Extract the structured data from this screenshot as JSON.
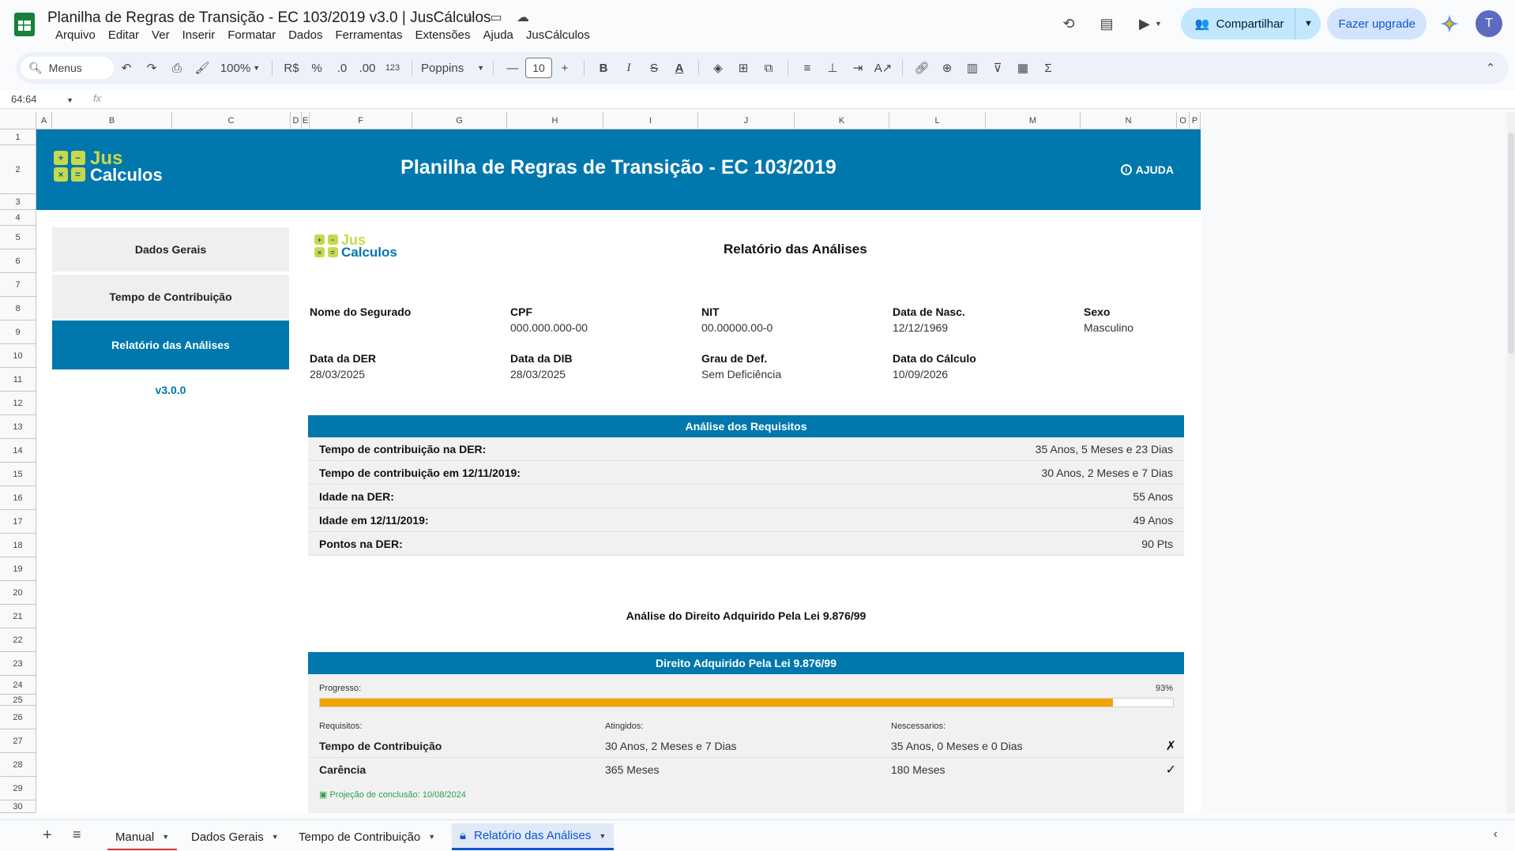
{
  "app": {
    "title": "Planilha de Regras de Transição - EC 103/2019 v3.0 | JusCálculos",
    "menu": [
      "Arquivo",
      "Editar",
      "Ver",
      "Inserir",
      "Formatar",
      "Dados",
      "Ferramentas",
      "Extensões",
      "Ajuda",
      "JusCálculos"
    ],
    "share_label": "Compartilhar",
    "upgrade_label": "Fazer upgrade",
    "avatar_letter": "T"
  },
  "toolbar": {
    "search_label": "Menus",
    "zoom": "100%",
    "currency": "R$",
    "percent": "%",
    "dec_decrease": ".0",
    "dec_increase": ".00",
    "number_format": "123",
    "font": "Poppins",
    "font_size": "10"
  },
  "formula_bar": {
    "cell_ref": "64:64",
    "fx": "fx"
  },
  "columns": [
    "A",
    "B",
    "C",
    "D",
    "E",
    "F",
    "G",
    "H",
    "I",
    "J",
    "K",
    "L",
    "M",
    "N",
    "O",
    "P"
  ],
  "rows": [
    "1",
    "2",
    "3",
    "4",
    "5",
    "6",
    "7",
    "8",
    "9",
    "10",
    "11",
    "12",
    "13",
    "14",
    "15",
    "16",
    "17",
    "18",
    "19",
    "20",
    "21",
    "22",
    "23",
    "24",
    "25",
    "26",
    "27",
    "28",
    "29",
    "30"
  ],
  "banner": {
    "title": "Planilha de Regras de Transição - EC 103/2019",
    "help_label": "AJUDA",
    "logo_top": "Jus",
    "logo_bottom": "Calculos"
  },
  "nav": {
    "items": [
      "Dados Gerais",
      "Tempo de Contribuição",
      "Relatório das Análises"
    ],
    "version": "v3.0.0"
  },
  "report": {
    "title": "Relatório das Análises",
    "fields": [
      {
        "label": "Nome do Segurado",
        "value": ""
      },
      {
        "label": "CPF",
        "value": "000.000.000-00"
      },
      {
        "label": "NIT",
        "value": "00.00000.00-0"
      },
      {
        "label": "Data de Nasc.",
        "value": "12/12/1969"
      },
      {
        "label": "Sexo",
        "value": "Masculino"
      },
      {
        "label": "Data da DER",
        "value": "28/03/2025"
      },
      {
        "label": "Data da DIB",
        "value": "28/03/2025"
      },
      {
        "label": "Grau de Def.",
        "value": "Sem Deficiência"
      },
      {
        "label": "Data do Cálculo",
        "value": "10/09/2026"
      }
    ],
    "requirements_header": "Análise dos Requisitos",
    "requirements": [
      {
        "label": "Tempo de contribuição na DER:",
        "value": "35 Anos, 5 Meses e 23 Dias"
      },
      {
        "label": "Tempo de contribuição em 12/11/2019:",
        "value": "30 Anos, 2 Meses e 7 Dias"
      },
      {
        "label": "Idade na DER:",
        "value": "55 Anos"
      },
      {
        "label": "Idade em 12/11/2019:",
        "value": "49 Anos"
      },
      {
        "label": "Pontos na DER:",
        "value": "90 Pts"
      }
    ],
    "section_title": "Análise do Direito Adquirido Pela Lei 9.876/99",
    "panel": {
      "header": "Direito Adquirido Pela Lei 9.876/99",
      "progress_label": "Progresso:",
      "progress_text": "93%",
      "progress_fraction": 0.93,
      "col_requisitos": "Requisitos:",
      "col_atingidos": "Atingidos:",
      "col_necessarios": "Nescessarios:",
      "rows": [
        {
          "req": "Tempo de Contribuição",
          "atingido": "30 Anos, 2 Meses e 7 Dias",
          "necessario": "35 Anos, 0 Meses e 0 Dias",
          "status": "✗"
        },
        {
          "req": "Carência",
          "atingido": "365 Meses",
          "necessario": "180 Meses",
          "status": "✓"
        }
      ],
      "projection": "Projeção de conclusão: 10/08/2024"
    }
  },
  "tabs": [
    "Manual",
    "Dados Gerais",
    "Tempo de Contribuição",
    "Relatório das Análises"
  ],
  "colors": {
    "brand_blue": "#0077ad",
    "progress": "#f4a300",
    "logo_green": "#c7d94b"
  }
}
